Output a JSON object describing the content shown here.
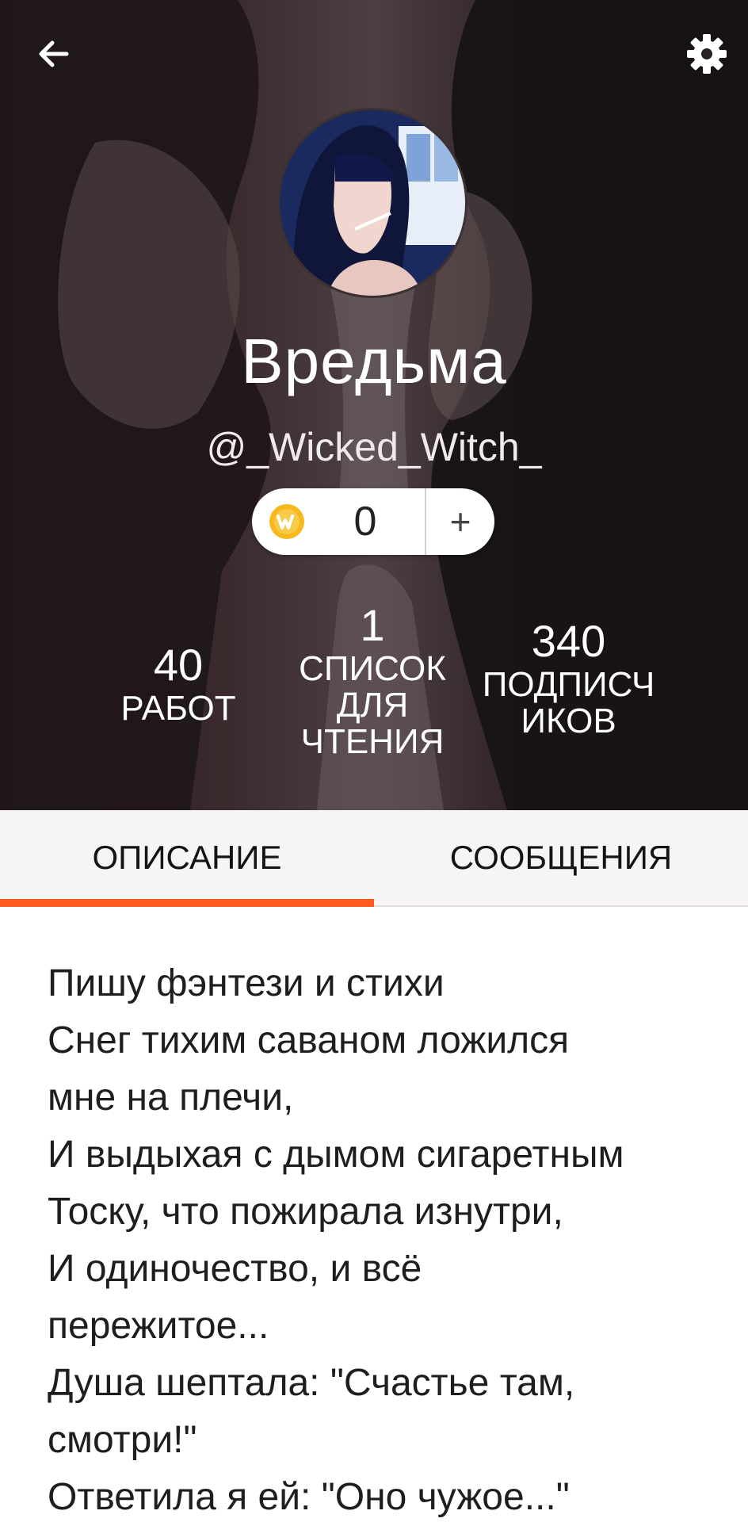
{
  "profile": {
    "display_name": "Вредьма",
    "username": "@_Wicked_Witch_",
    "coins": "0",
    "add_coins_label": "+"
  },
  "stats": {
    "works": {
      "count": "40",
      "label": "РАБОТ"
    },
    "reading_lists": {
      "count": "1",
      "label_lines": [
        "СПИСОК",
        "ДЛЯ",
        "ЧТЕНИЯ"
      ]
    },
    "followers": {
      "count": "340",
      "label_lines": [
        "ПОДПИСЧ",
        "ИКОВ"
      ]
    }
  },
  "tabs": [
    {
      "label": "ОПИСАНИЕ",
      "active": true
    },
    {
      "label": "СООБЩЕНИЯ",
      "active": false
    }
  ],
  "description_lines": [
    "Пишу фэнтези и стихи",
    "Снег тихим саваном ложился",
    "мне на плечи,",
    "И выдыхая с дымом сигаретным",
    "Тоску, что пожирала изнутри,",
    "И одиночество, и всё",
    "пережитое...",
    "Душа шептала: \"Счастье там,",
    "смотри!\"",
    "Ответила я ей: \"Оно чужое...\""
  ],
  "icons": {
    "back": "arrow-left-icon",
    "settings": "gear-icon",
    "coin": "wattpad-coin-icon"
  },
  "colors": {
    "accent": "#ff5a1f",
    "coin": "#f7b81c"
  }
}
